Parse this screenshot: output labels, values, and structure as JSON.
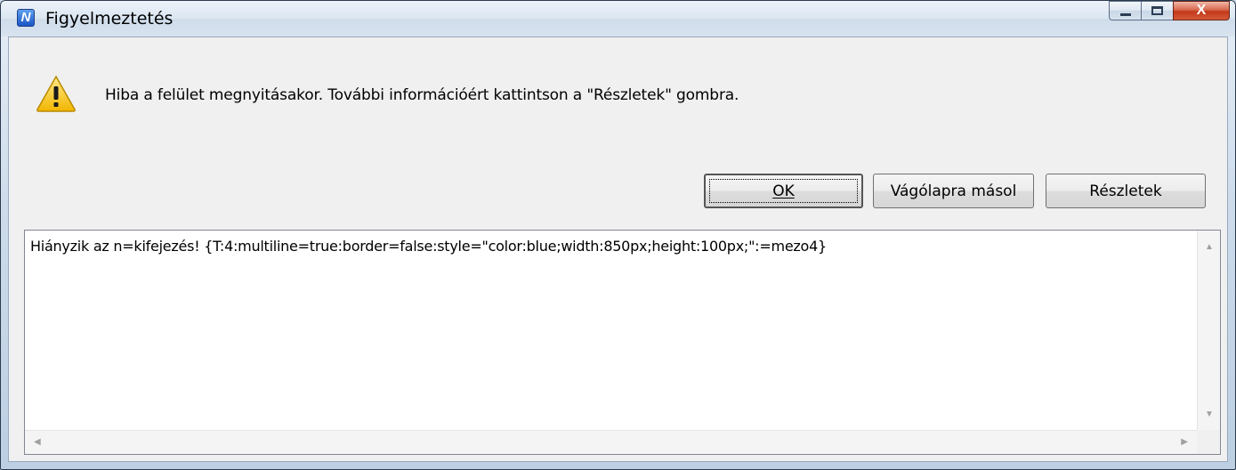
{
  "window": {
    "title": "Figyelmeztetés",
    "app_icon_glyph": "N",
    "close_glyph": "X"
  },
  "dialog": {
    "message": "Hiba a felület megnyitásakor. További információért kattintson a \"Részletek\" gombra.",
    "icon": "warning-icon"
  },
  "buttons": {
    "ok_label": "OK",
    "copy_label": "Vágólapra másol",
    "details_label": "Részletek"
  },
  "details": {
    "text": "Hiányzik az n=kifejezés! {T:4:multiline=true:border=false:style=\"color:blue;width:850px;height:100px;\":=mezo4}"
  },
  "scrollbar": {
    "up": "▲",
    "down": "▼",
    "left": "◀",
    "right": "▶"
  },
  "colors": {
    "accent": "#1b56c6",
    "close": "#c2391b",
    "warning": "#f2c500"
  }
}
